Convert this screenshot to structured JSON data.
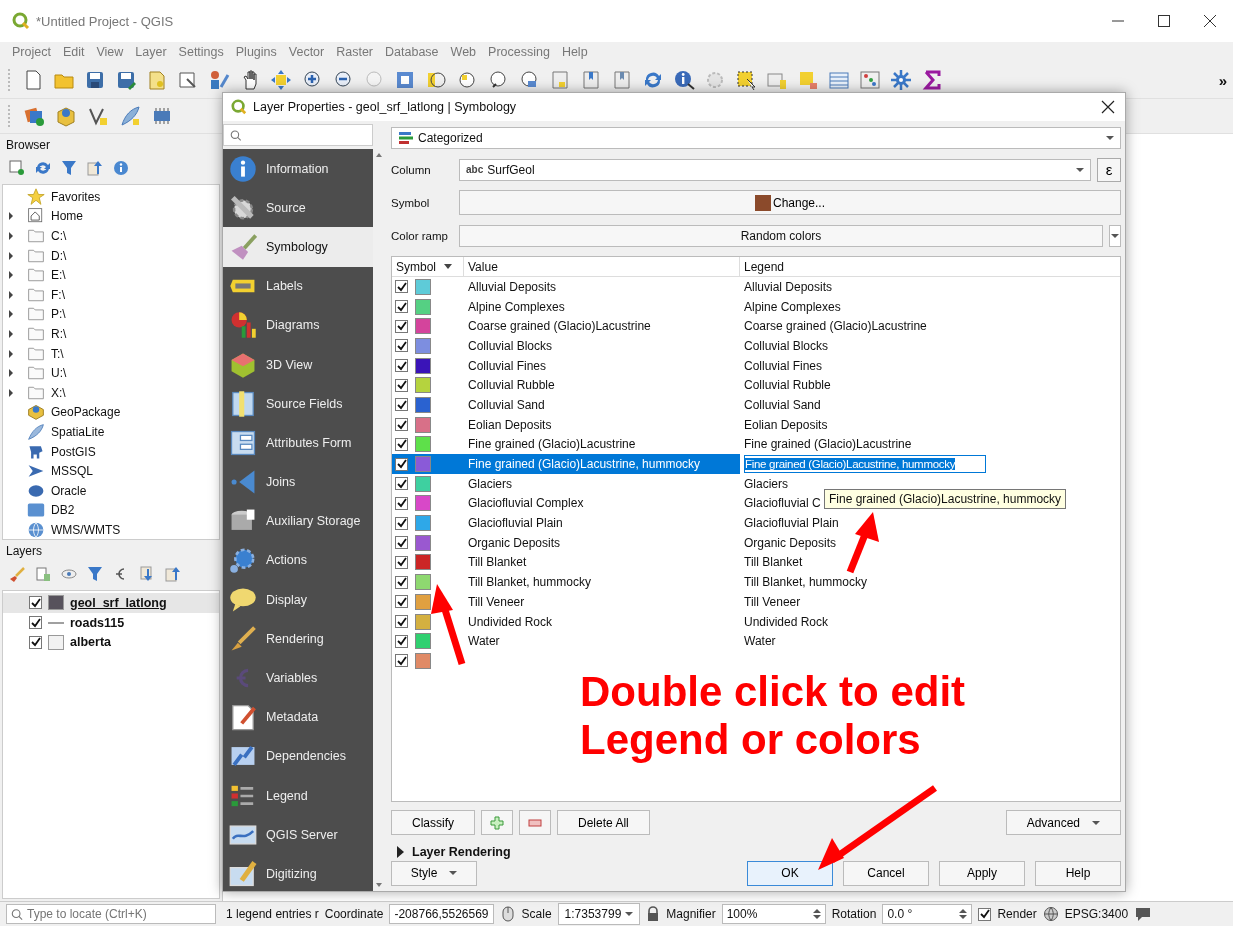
{
  "window": {
    "title": "*Untitled Project - QGIS"
  },
  "menu": [
    "Project",
    "Edit",
    "View",
    "Layer",
    "Settings",
    "Plugins",
    "Vector",
    "Raster",
    "Database",
    "Web",
    "Processing",
    "Help"
  ],
  "toolbar_overflow": "»",
  "browser": {
    "title": "Browser",
    "items": [
      {
        "label": "Favorites",
        "expandable": false
      },
      {
        "label": "Home",
        "expandable": true
      },
      {
        "label": "C:\\",
        "expandable": true
      },
      {
        "label": "D:\\",
        "expandable": true
      },
      {
        "label": "E:\\",
        "expandable": true
      },
      {
        "label": "F:\\",
        "expandable": true
      },
      {
        "label": "P:\\",
        "expandable": true
      },
      {
        "label": "R:\\",
        "expandable": true
      },
      {
        "label": "T:\\",
        "expandable": true
      },
      {
        "label": "U:\\",
        "expandable": true
      },
      {
        "label": "X:\\",
        "expandable": true
      },
      {
        "label": "GeoPackage",
        "expandable": false
      },
      {
        "label": "SpatiaLite",
        "expandable": false
      },
      {
        "label": "PostGIS",
        "expandable": false
      },
      {
        "label": "MSSQL",
        "expandable": false
      },
      {
        "label": "Oracle",
        "expandable": false
      },
      {
        "label": "DB2",
        "expandable": false
      },
      {
        "label": "WMS/WMTS",
        "expandable": false
      }
    ]
  },
  "layers": {
    "title": "Layers",
    "items": [
      {
        "name": "geol_srf_latlong",
        "checked": true,
        "selected": true,
        "kind": "polygon",
        "color": "#57525c"
      },
      {
        "name": "roads115",
        "checked": true,
        "selected": false,
        "kind": "line",
        "color": "#a0a0a0"
      },
      {
        "name": "alberta",
        "checked": true,
        "selected": false,
        "kind": "polygon",
        "color": "#f2f2f2"
      }
    ]
  },
  "dialog": {
    "title": "Layer Properties - geol_srf_latlong | Symbology",
    "sidebar": [
      {
        "label": "Information",
        "selected": false
      },
      {
        "label": "Source",
        "selected": false
      },
      {
        "label": "Symbology",
        "selected": true
      },
      {
        "label": "Labels",
        "selected": false
      },
      {
        "label": "Diagrams",
        "selected": false
      },
      {
        "label": "3D View",
        "selected": false
      },
      {
        "label": "Source Fields",
        "selected": false
      },
      {
        "label": "Attributes Form",
        "selected": false
      },
      {
        "label": "Joins",
        "selected": false
      },
      {
        "label": "Auxiliary Storage",
        "selected": false
      },
      {
        "label": "Actions",
        "selected": false
      },
      {
        "label": "Display",
        "selected": false
      },
      {
        "label": "Rendering",
        "selected": false
      },
      {
        "label": "Variables",
        "selected": false
      },
      {
        "label": "Metadata",
        "selected": false
      },
      {
        "label": "Dependencies",
        "selected": false
      },
      {
        "label": "Legend",
        "selected": false
      },
      {
        "label": "QGIS Server",
        "selected": false
      },
      {
        "label": "Digitizing",
        "selected": false
      }
    ],
    "renderer": "Categorized",
    "column_label": "Column",
    "column_type": "abc",
    "column_value": "SurfGeol",
    "expression_button": "ε",
    "symbol_label": "Symbol",
    "symbol_button": "Change...",
    "ramp_label": "Color ramp",
    "ramp_value": "Random colors",
    "table": {
      "columns": [
        "Symbol",
        "Value",
        "Legend"
      ],
      "rows": [
        {
          "checked": true,
          "color": "#5ecbd8",
          "value": "Alluvial Deposits",
          "legend": "Alluvial Deposits",
          "selected": false,
          "editing": false
        },
        {
          "checked": true,
          "color": "#55d083",
          "value": "Alpine Complexes",
          "legend": "Alpine Complexes",
          "selected": false,
          "editing": false
        },
        {
          "checked": true,
          "color": "#d4449c",
          "value": "Coarse grained (Glacio)Lacustrine",
          "legend": "Coarse grained (Glacio)Lacustrine",
          "selected": false,
          "editing": false
        },
        {
          "checked": true,
          "color": "#7d8ee0",
          "value": "Colluvial Blocks",
          "legend": "Colluvial Blocks",
          "selected": false,
          "editing": false
        },
        {
          "checked": true,
          "color": "#3a14b8",
          "value": "Colluvial Fines",
          "legend": "Colluvial Fines",
          "selected": false,
          "editing": false
        },
        {
          "checked": true,
          "color": "#b5d33e",
          "value": "Colluvial Rubble",
          "legend": "Colluvial Rubble",
          "selected": false,
          "editing": false
        },
        {
          "checked": true,
          "color": "#2a62d0",
          "value": "Colluvial Sand",
          "legend": "Colluvial Sand",
          "selected": false,
          "editing": false
        },
        {
          "checked": true,
          "color": "#d87088",
          "value": "Eolian Deposits",
          "legend": "Eolian Deposits",
          "selected": false,
          "editing": false
        },
        {
          "checked": true,
          "color": "#5ee04a",
          "value": "Fine grained (Glacio)Lacustrine",
          "legend": "Fine grained (Glacio)Lacustrine",
          "selected": false,
          "editing": false
        },
        {
          "checked": true,
          "color": "#8a5ad8",
          "value": "Fine grained (Glacio)Lacustrine, hummocky",
          "legend": "Fine grained (Glacio)Lacustrine, hummocky",
          "selected": true,
          "editing": true
        },
        {
          "checked": true,
          "color": "#3ed0a0",
          "value": "Glaciers",
          "legend": "Glaciers",
          "selected": false,
          "editing": false
        },
        {
          "checked": true,
          "color": "#d848c8",
          "value": "Glaciofluvial Complex",
          "legend": "Glaciofluvial C",
          "selected": false,
          "editing": false
        },
        {
          "checked": true,
          "color": "#2ea8e8",
          "value": "Glaciofluvial Plain",
          "legend": "Glaciofluvial Plain",
          "selected": false,
          "editing": false
        },
        {
          "checked": true,
          "color": "#9a58d0",
          "value": "Organic Deposits",
          "legend": "Organic Deposits",
          "selected": false,
          "editing": false
        },
        {
          "checked": true,
          "color": "#cc2626",
          "value": "Till Blanket",
          "legend": "Till Blanket",
          "selected": false,
          "editing": false
        },
        {
          "checked": true,
          "color": "#8ed870",
          "value": "Till Blanket, hummocky",
          "legend": "Till Blanket, hummocky",
          "selected": false,
          "editing": false
        },
        {
          "checked": true,
          "color": "#e0a040",
          "value": "Till Veneer",
          "legend": "Till Veneer",
          "selected": false,
          "editing": false
        },
        {
          "checked": true,
          "color": "#d4b040",
          "value": "Undivided Rock",
          "legend": "Undivided Rock",
          "selected": false,
          "editing": false
        },
        {
          "checked": true,
          "color": "#30d070",
          "value": "Water",
          "legend": "Water",
          "selected": false,
          "editing": false
        },
        {
          "checked": true,
          "color": "#e08a66",
          "selected": false,
          "editing": false
        }
      ]
    },
    "tooltip": "Fine grained (Glacio)Lacustrine, hummocky",
    "classify_button": "Classify",
    "delete_all_button": "Delete All",
    "advanced_button": "Advanced",
    "layer_rendering": {
      "label": "Layer Rendering",
      "expanded": false
    },
    "style_button": "Style",
    "buttons": [
      "OK",
      "Cancel",
      "Apply",
      "Help"
    ]
  },
  "status_bar": {
    "locate_placeholder": "Type to locate (Ctrl+K)",
    "message": "1 legend entries r",
    "coordinate_label": "Coordinate",
    "coordinate": "-208766,5526569",
    "scale_label": "Scale",
    "scale": "1:7353799",
    "magnifier_label": "Magnifier",
    "magnifier": "100%",
    "rotation_label": "Rotation",
    "rotation": "0.0 °",
    "render_label": "Render",
    "render_checked": true,
    "crs": "EPSG:3400"
  },
  "annotation": {
    "lines": [
      "Double click to edit",
      "Legend or colors"
    ]
  }
}
